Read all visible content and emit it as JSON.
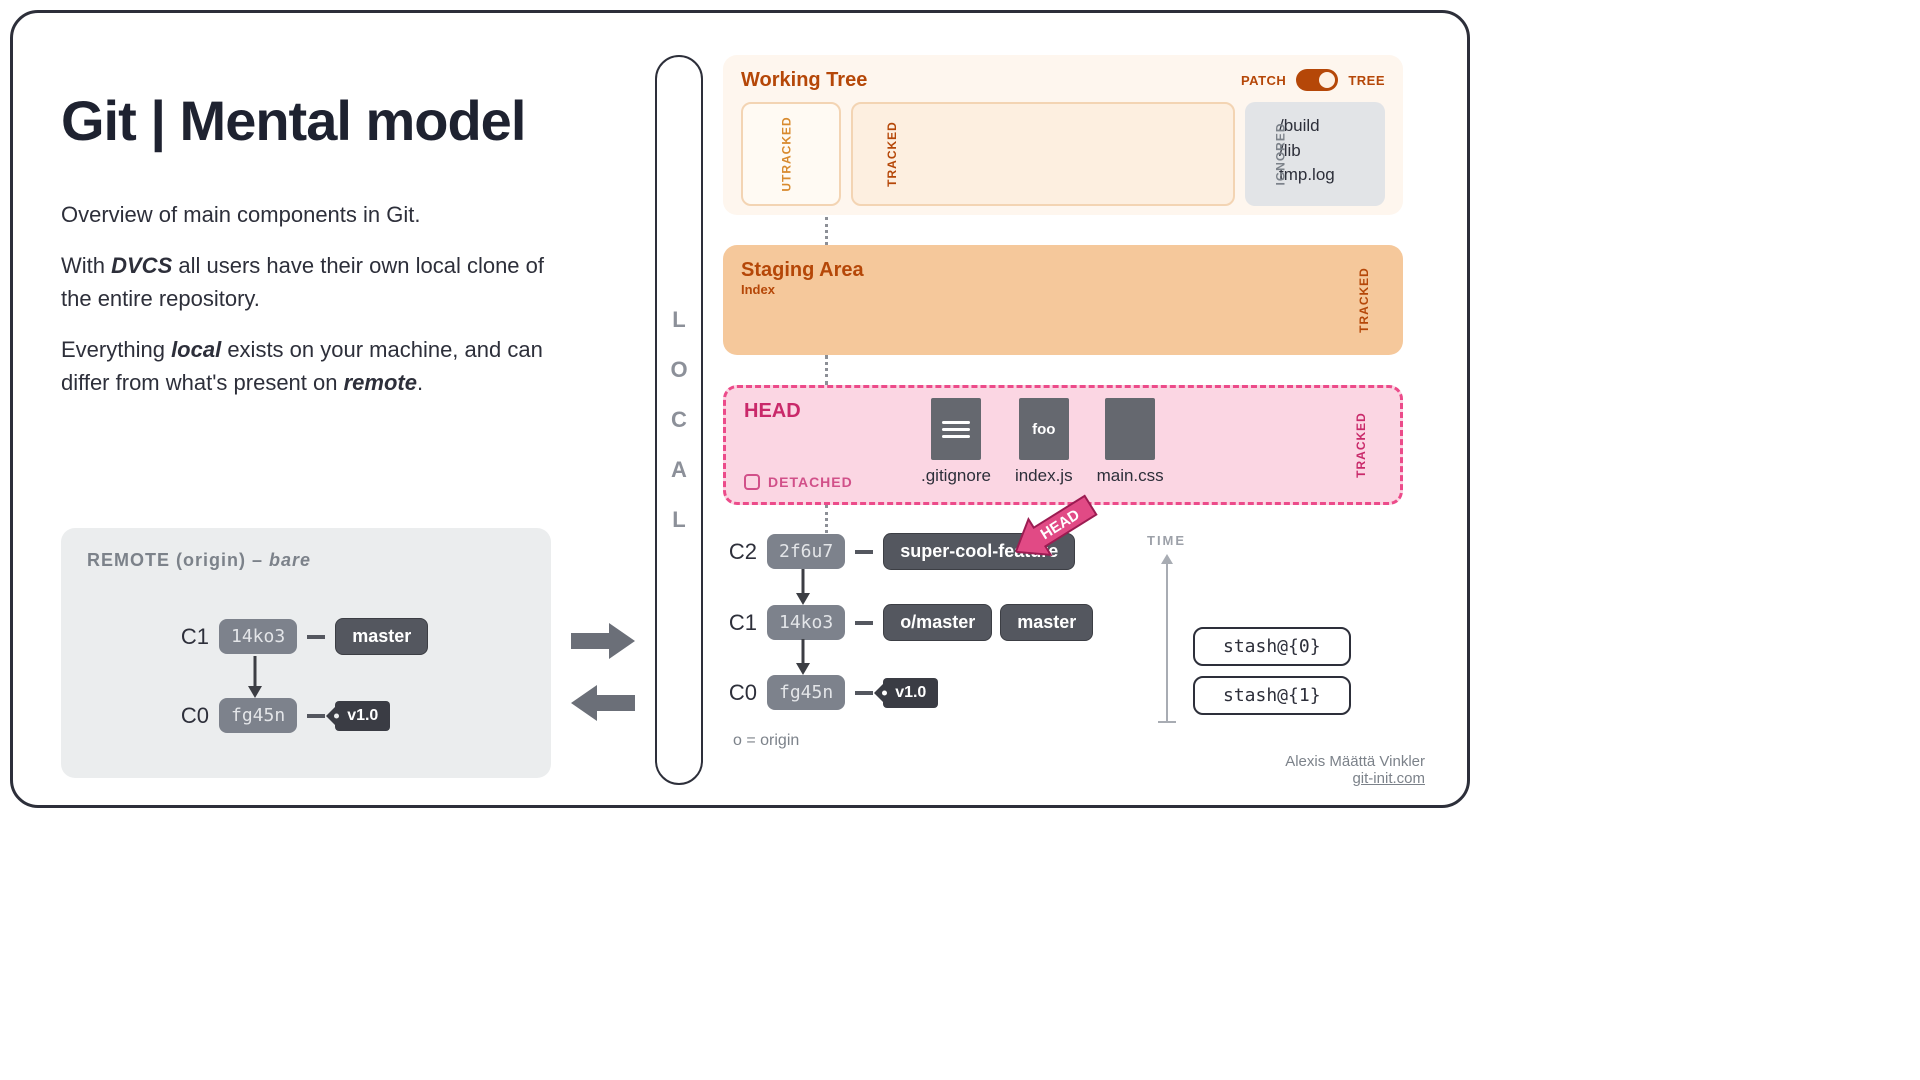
{
  "title": "Git | Mental model",
  "desc": {
    "p1": "Overview of main components in Git.",
    "p2a": "With ",
    "p2b": "DVCS",
    "p2c": " all users have their own local clone of the entire repository.",
    "p3a": "Everything ",
    "p3b": "local",
    "p3c": " exists on your machine, and can differ from what's present on ",
    "p3d": "remote",
    "p3e": "."
  },
  "remote": {
    "label_a": "REMOTE (origin) – ",
    "label_b": "bare",
    "c1": {
      "id": "C1",
      "hash": "14ko3",
      "branch": "master"
    },
    "c0": {
      "id": "C0",
      "hash": "fg45n",
      "tag": "v1.0"
    }
  },
  "local_pill": [
    "L",
    "O",
    "C",
    "A",
    "L"
  ],
  "working_tree": {
    "title": "Working Tree",
    "toggle_left": "PATCH",
    "toggle_right": "TREE",
    "utracked": "UTRACKED",
    "tracked": "TRACKED",
    "ignored_label": "IGNORED",
    "ignored": [
      "/build",
      "/lib",
      "tmp.log"
    ]
  },
  "staging": {
    "title": "Staging Area",
    "sub": "Index",
    "tracked": "TRACKED"
  },
  "head": {
    "title": "HEAD",
    "detached": "DETACHED",
    "tracked": "TRACKED",
    "arrow_text": "HEAD",
    "files": [
      {
        "name": ".gitignore",
        "kind": "lines"
      },
      {
        "name": "index.js",
        "kind": "foo",
        "text": "foo"
      },
      {
        "name": "main.css",
        "kind": "blank"
      }
    ]
  },
  "local_commits": {
    "c2": {
      "id": "C2",
      "hash": "2f6u7",
      "branch": "super-cool-feature"
    },
    "c1": {
      "id": "C1",
      "hash": "14ko3",
      "branch1": "o/master",
      "branch2": "master"
    },
    "c0": {
      "id": "C0",
      "hash": "fg45n",
      "tag": "v1.0"
    },
    "origin_note": "o = origin",
    "time_label": "TIME"
  },
  "stash": [
    "stash@{0}",
    "stash@{1}"
  ],
  "footer": {
    "author": "Alexis Määttä Vinkler",
    "site": "git-init.com"
  }
}
